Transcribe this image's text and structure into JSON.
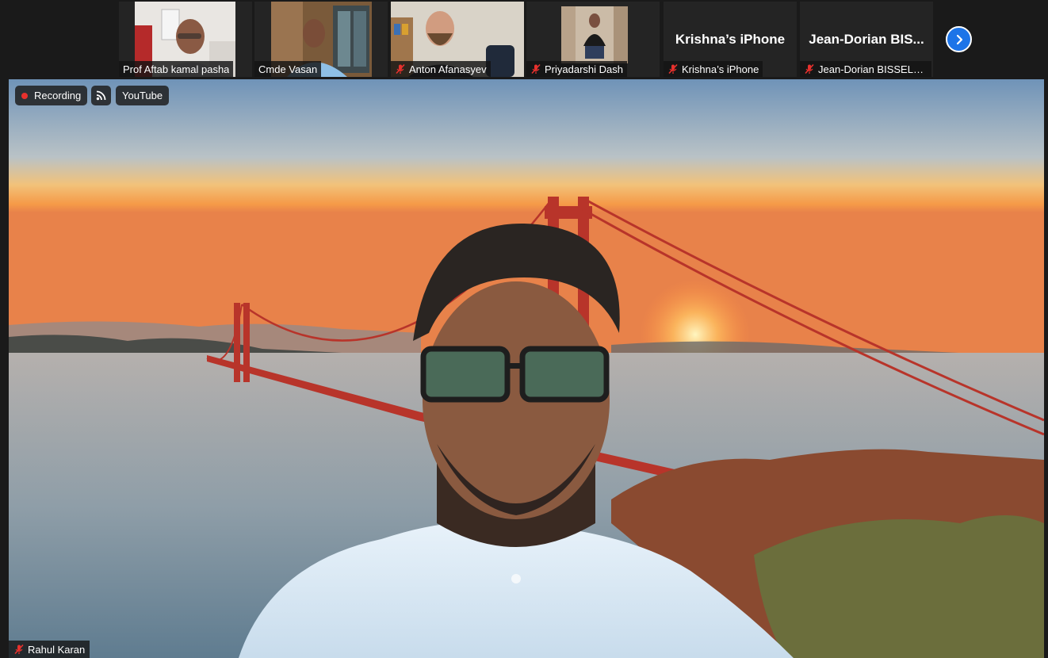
{
  "participants": [
    {
      "name": "Prof Aftab kamal pasha",
      "muted": false
    },
    {
      "name": "Cmde Vasan",
      "muted": false
    },
    {
      "name": "Anton Afanasyev",
      "muted": true
    },
    {
      "name": "Priyadarshi Dash",
      "muted": true
    },
    {
      "name": "Krishna’s iPhone",
      "display_name": "Krishna’s iPhone",
      "muted": true
    },
    {
      "name": "Jean-Dorian BISSELO B...",
      "display_name": "Jean-Dorian  BIS...",
      "muted": true
    }
  ],
  "next_page_icon": "chevron-right-icon",
  "status": {
    "recording_label": "Recording",
    "live_icon": "rss-feed-icon",
    "stream_label": "YouTube"
  },
  "speaker": {
    "name": "Rahul Karan",
    "muted": true
  },
  "colors": {
    "accent_blue": "#1c74e8",
    "recording_red": "#e8312d",
    "muted_red": "#e8312d",
    "bridge_red": "#b8342a"
  }
}
